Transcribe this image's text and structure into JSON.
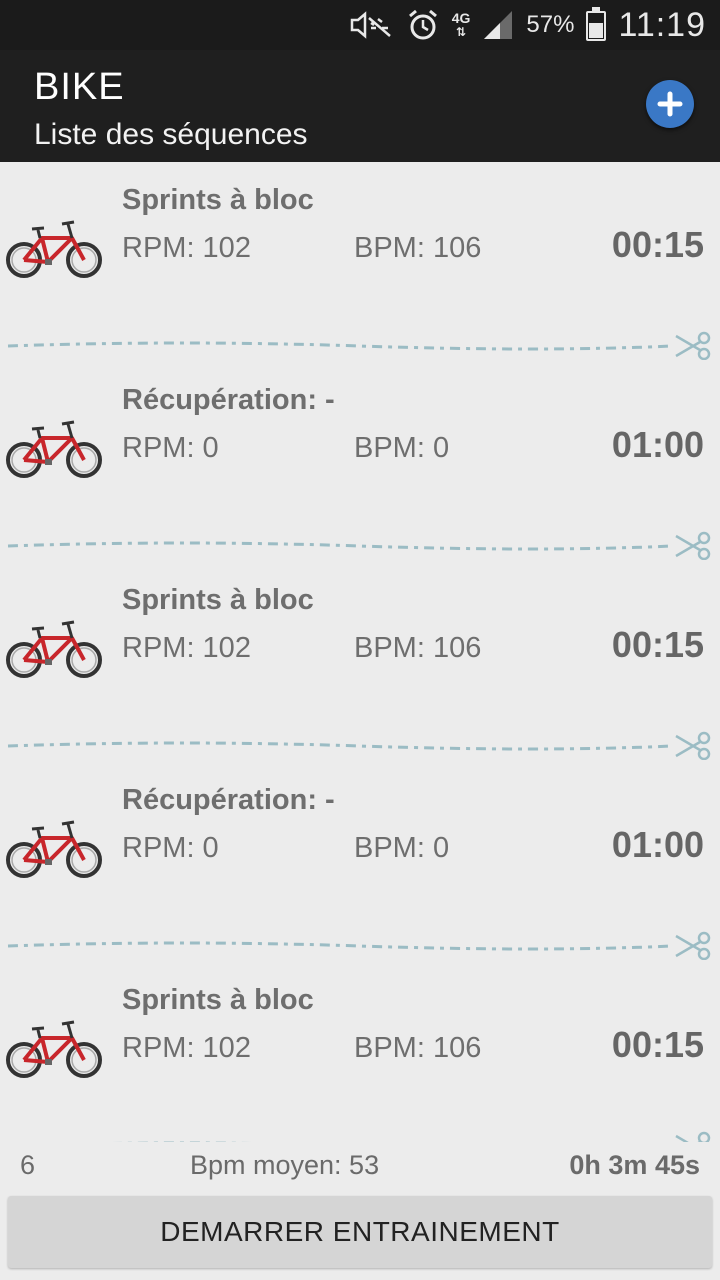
{
  "status_bar": {
    "network": "4G",
    "battery_percent": "57%",
    "battery_level": 0.57,
    "time": "11:19",
    "icons": [
      "mute-icon",
      "alarm-icon",
      "network-icon",
      "signal-icon",
      "battery-icon"
    ]
  },
  "app_bar": {
    "title": "BIKE",
    "subtitle": "Liste des séquences",
    "add_icon": "plus-icon"
  },
  "sequences": [
    {
      "name": "Sprints à bloc",
      "rpm": "RPM: 102",
      "bpm": "BPM: 106",
      "duration": "00:15"
    },
    {
      "name": "Récupération: -",
      "rpm": "RPM: 0",
      "bpm": "BPM: 0",
      "duration": "01:00"
    },
    {
      "name": "Sprints à bloc",
      "rpm": "RPM: 102",
      "bpm": "BPM: 106",
      "duration": "00:15"
    },
    {
      "name": "Récupération: -",
      "rpm": "RPM: 0",
      "bpm": "BPM: 0",
      "duration": "01:00"
    },
    {
      "name": "Sprints à bloc",
      "rpm": "RPM: 102",
      "bpm": "BPM: 106",
      "duration": "00:15"
    }
  ],
  "footer": {
    "count": "6",
    "avg_bpm": "Bpm moyen: 53",
    "total_time": "0h 3m 45s"
  },
  "start_button": "DEMARRER ENTRAINEMENT",
  "colors": {
    "accent": "#3a78c6",
    "bike_frame": "#c8262b",
    "cut_line": "#9bbcc4",
    "app_bar": "#1f1f1f"
  }
}
